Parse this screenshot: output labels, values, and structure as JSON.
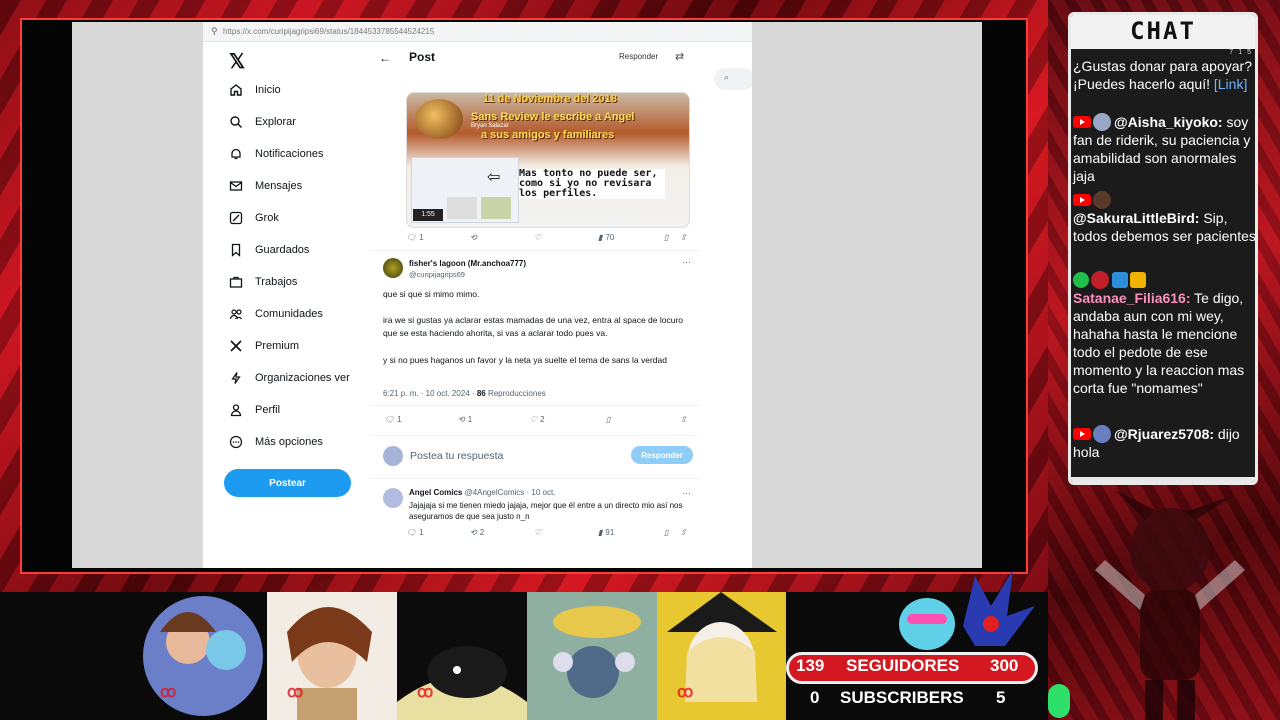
{
  "browser": {
    "url": "https://x.com/curipijagripsi69/status/1844533785544524215"
  },
  "sidebar": {
    "items": [
      {
        "label": "Inicio",
        "icon": "home-icon"
      },
      {
        "label": "Explorar",
        "icon": "search-icon"
      },
      {
        "label": "Notificaciones",
        "icon": "bell-icon"
      },
      {
        "label": "Mensajes",
        "icon": "mail-icon"
      },
      {
        "label": "Grok",
        "icon": "grok-icon"
      },
      {
        "label": "Guardados",
        "icon": "bookmark-icon"
      },
      {
        "label": "Trabajos",
        "icon": "briefcase-icon"
      },
      {
        "label": "Comunidades",
        "icon": "people-icon"
      },
      {
        "label": "Premium",
        "icon": "x-logo-icon"
      },
      {
        "label": "Organizaciones ver",
        "icon": "lightning-icon"
      },
      {
        "label": "Perfil",
        "icon": "person-icon"
      },
      {
        "label": "Más opciones",
        "icon": "more-icon"
      }
    ],
    "post_button": "Postear"
  },
  "header": {
    "title": "Post",
    "reply_label": "Responder"
  },
  "media_post": {
    "image_date": "11 de Noviembre del 2018",
    "image_line1": "Sans Review le escribe a Angel",
    "image_line2": "a sus amigos y familiares",
    "image_author": "Bryan Salazar",
    "image_caption": "Mas tonto no puede ser, como si yo no revisara los perfiles.",
    "image_duration": "1:55",
    "stats": {
      "replies": "1",
      "reposts": "",
      "likes": "",
      "views": "70"
    }
  },
  "main_post": {
    "author": "fisher's lagoon (Mr.anchoa777)",
    "handle": "@curipijagrips69",
    "paragraphs": [
      "que si que si mimo mimo.",
      "ira we si gustas ya aclarar estas mamadas de una vez, entra al space de locuro que se esta haciendo ahorita, si vas a aclarar todo pues va.",
      "y si no pues haganos un favor y la neta ya suelte el tema de sans la verdad"
    ],
    "timestamp": "6:21 p. m. · 10 oct. 2024 · ",
    "views_count": "86",
    "views_label": " Reproducciones",
    "stats": {
      "replies": "1",
      "reposts": "1",
      "likes": "2"
    }
  },
  "reply_box": {
    "placeholder": "Postea tu respuesta",
    "button": "Responder"
  },
  "comment": {
    "author": "Angel Comics",
    "handle_date": " @4AngelComics · 10 oct.",
    "text": "Jajajaja si me tienen miedo jajaja, mejor que él entre a un directo mio así nos aseguramos de que sea justo n_n",
    "stats": {
      "replies": "1",
      "reposts": "2",
      "likes": "",
      "views": "91"
    }
  },
  "chat": {
    "title": "CHAT",
    "counts": {
      "a": "7",
      "b": "1",
      "c": "5"
    },
    "messages": [
      {
        "user": "",
        "text": "¿Gustas donar para apoyar? ¡Puedes hacerlo aquí! ",
        "link": "[Link]"
      },
      {
        "user": "@Aisha_kiyoko:",
        "text": " soy fan de riderik, su paciencia y amabilidad son anormales jaja"
      },
      {
        "user": "@SakuraLittleBird:",
        "text": " Sip, todos debemos ser pacientes"
      },
      {
        "user": "Satanae_Filia616:",
        "text": " Te digo, andaba aun con mi wey, hahaha hasta le mencione todo el pedote de ese momento y la reaccion mas corta fue \"nomames\""
      },
      {
        "user": "@Rjuarez5708:",
        "text": " dijo hola"
      }
    ]
  },
  "stream_stats": {
    "followers_current": "139",
    "followers_label": "SEGUIDORES",
    "followers_goal": "300",
    "subs_current": "0",
    "subs_label": "SUBSCRIBERS",
    "subs_goal": "5"
  },
  "colors": {
    "accent": "#1d9bf0",
    "frame_red": "#c41420",
    "youtube_red": "#ff0000"
  }
}
